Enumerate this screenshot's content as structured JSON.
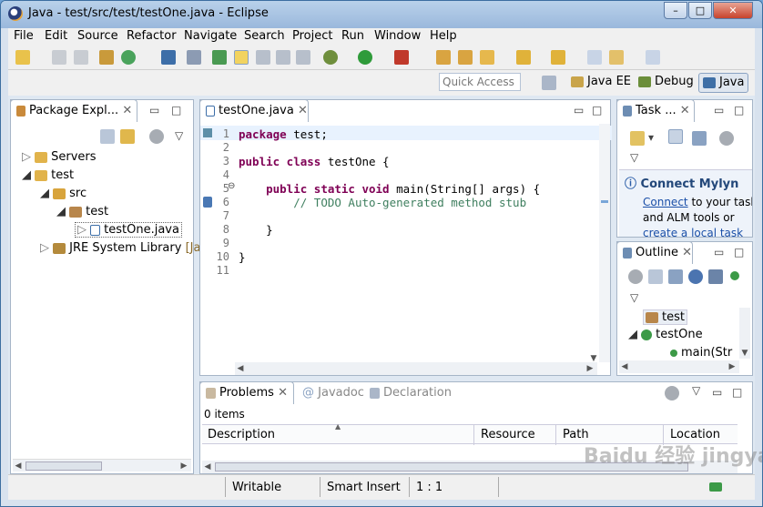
{
  "window": {
    "title": "Java - test/src/test/testOne.java - Eclipse",
    "min": "–",
    "max": "□",
    "close": "✕"
  },
  "menu": [
    "File",
    "Edit",
    "Source",
    "Refactor",
    "Navigate",
    "Search",
    "Project",
    "Run",
    "Window",
    "Help"
  ],
  "quick_access": {
    "placeholder": "Quick Access"
  },
  "perspectives": [
    "Java EE",
    "Debug",
    "Java"
  ],
  "package_explorer": {
    "tab": "Package Expl...",
    "tree": [
      {
        "label": "Servers",
        "indent": 0
      },
      {
        "label": "test",
        "indent": 0
      },
      {
        "label": "src",
        "indent": 1
      },
      {
        "label": "test",
        "indent": 2
      },
      {
        "label": "testOne.java",
        "indent": 3
      },
      {
        "label": "JRE System Library",
        "indent": 1,
        "suffix": "[Jav"
      }
    ]
  },
  "editor": {
    "tab": "testOne.java",
    "lines": [
      "1",
      "2",
      "3",
      "4",
      "5",
      "6",
      "7",
      "8",
      "9",
      "10",
      "11"
    ],
    "code": {
      "l1kw": "package",
      "l1": " test;",
      "l3kw": "public class",
      "l3": " testOne {",
      "l5kw": "public static void",
      "l5": " main(String[] args) {",
      "l6": "// TODO Auto-generated method stub",
      "l8": "}",
      "l10": "}"
    }
  },
  "task_list": {
    "tab": "Task ...",
    "mylyn_title": "Connect Mylyn",
    "mylyn_link": "Connect",
    "mylyn_text": " to your task",
    "mylyn_line2": "and ALM tools or",
    "mylyn_line3": "create a local task"
  },
  "outline": {
    "tab": "Outline",
    "items": [
      "test",
      "testOne",
      "main(Str"
    ]
  },
  "bottom": {
    "tabs": [
      "Problems",
      "Javadoc",
      "Declaration"
    ],
    "count": "0 items",
    "columns": [
      "Description",
      "Resource",
      "Path",
      "Location"
    ]
  },
  "status": {
    "writable": "Writable",
    "insert": "Smart Insert",
    "position": "1 : 1"
  },
  "watermark": "Baidu 经验 jingyan.baidu.com"
}
